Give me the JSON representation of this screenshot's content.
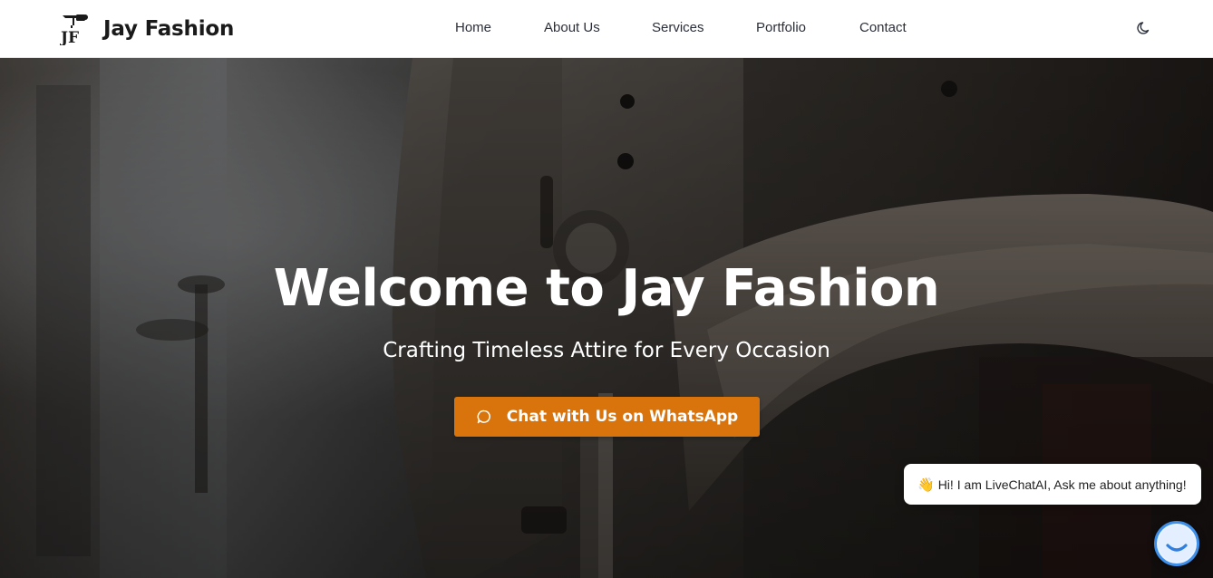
{
  "brand": {
    "logo_text": "JF",
    "name": "Jay Fashion"
  },
  "nav": {
    "items": [
      {
        "label": "Home"
      },
      {
        "label": "About Us"
      },
      {
        "label": "Services"
      },
      {
        "label": "Portfolio"
      },
      {
        "label": "Contact"
      }
    ],
    "theme_toggle_icon": "moon-icon"
  },
  "hero": {
    "title": "Welcome to Jay Fashion",
    "subtitle": "Crafting Timeless Attire for Every Occasion",
    "cta_label": "Chat with Us on WhatsApp",
    "cta_icon": "chat-bubble-icon",
    "background": "sewing-machine-photo"
  },
  "chat_widget": {
    "greeting_icon": "waving-hand-icon",
    "message": "Hi! I am LiveChatAI, Ask me about anything!",
    "launcher_icon": "smile-icon"
  },
  "colors": {
    "accent": "#d9740c",
    "nav_text": "#2b2f3a",
    "brand_text": "#1a1a1a",
    "launcher_border": "#3d8fe9"
  }
}
